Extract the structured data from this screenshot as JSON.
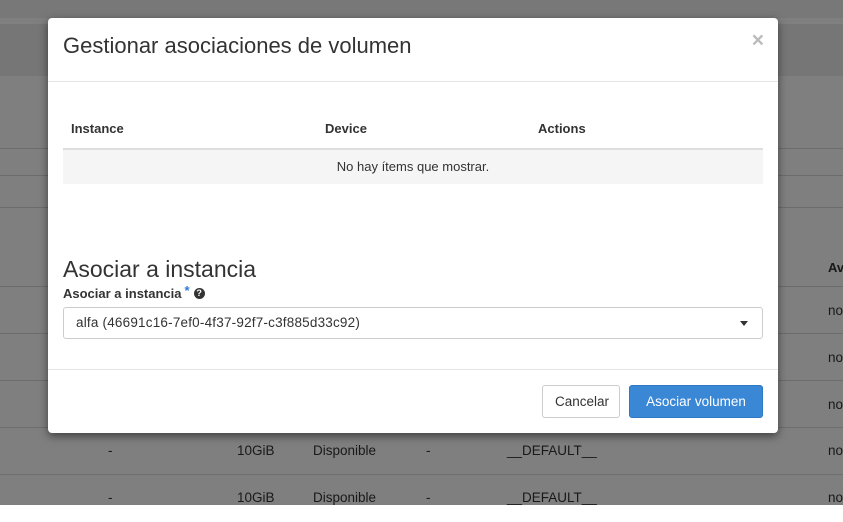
{
  "background": {
    "header_av": "Av",
    "rows": [
      {
        "name": "-",
        "size": "10GiB",
        "status": "Disponible",
        "attached": "-",
        "type": "__DEFAULT__",
        "trail": "no"
      },
      {
        "name": "-",
        "size": "10GiB",
        "status": "Disponible",
        "attached": "-",
        "type": "__DEFAULT__",
        "trail": "no"
      }
    ],
    "trail_cells": [
      "no",
      "no",
      "no"
    ]
  },
  "modal": {
    "title": "Gestionar asociaciones de volumen",
    "close_glyph": "×",
    "table": {
      "headers": [
        "Instance",
        "Device",
        "Actions"
      ],
      "empty_text": "No hay ítems que mostrar."
    },
    "section_title": "Asociar a instancia",
    "field": {
      "label": "Asociar a instancia",
      "required_mark": "*",
      "help_glyph": "?",
      "selected_value": "alfa (46691c16-7ef0-4f37-92f7-c3f885d33c92)"
    },
    "buttons": {
      "cancel": "Cancelar",
      "submit": "Asociar volumen"
    }
  }
}
